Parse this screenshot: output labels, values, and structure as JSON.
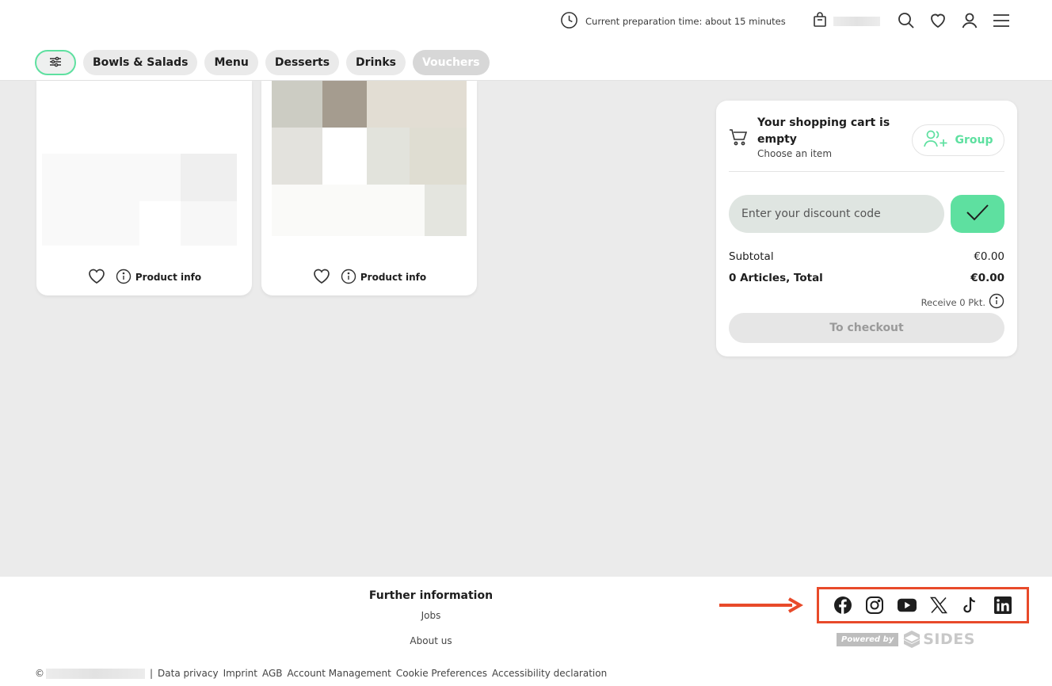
{
  "header": {
    "prep_time": "Current preparation time: about 15 minutes",
    "categories": [
      "Bowls & Salads",
      "Menu",
      "Desserts",
      "Drinks",
      "Vouchers"
    ],
    "icons": [
      "clock-icon",
      "shopping-bag-icon",
      "search-icon",
      "heart-icon",
      "user-icon",
      "menu-icon",
      "filter-icon"
    ]
  },
  "products": [
    {
      "product_info_label": "Product info"
    },
    {
      "product_info_label": "Product info"
    }
  ],
  "cart": {
    "title": "Your shopping cart is empty",
    "subtitle": "Choose an item",
    "group_label": "Group",
    "discount_placeholder": "Enter your discount code",
    "subtotal_label": "Subtotal",
    "subtotal_value": "€0.00",
    "total_label": "0 Articles, Total",
    "total_value": "€0.00",
    "receive_text": "Receive 0 Pkt.",
    "checkout_label": "To checkout"
  },
  "footer": {
    "further_title": "Further information",
    "links": [
      "Jobs",
      "About us"
    ],
    "social": [
      "facebook-icon",
      "instagram-icon",
      "youtube-icon",
      "x-icon",
      "tiktok-icon",
      "linkedin-icon"
    ],
    "powered_by": "Powered by",
    "brand": "SIDES",
    "copyright_symbol": "©",
    "separator": "|",
    "bottom_links": [
      "Data privacy",
      "Imprint",
      "AGB",
      "Account Management",
      "Cookie Preferences",
      "Accessibility declaration"
    ]
  },
  "colors": {
    "accent": "#5ee0a0",
    "highlight": "#e84a2a",
    "background": "#ebebeb"
  }
}
